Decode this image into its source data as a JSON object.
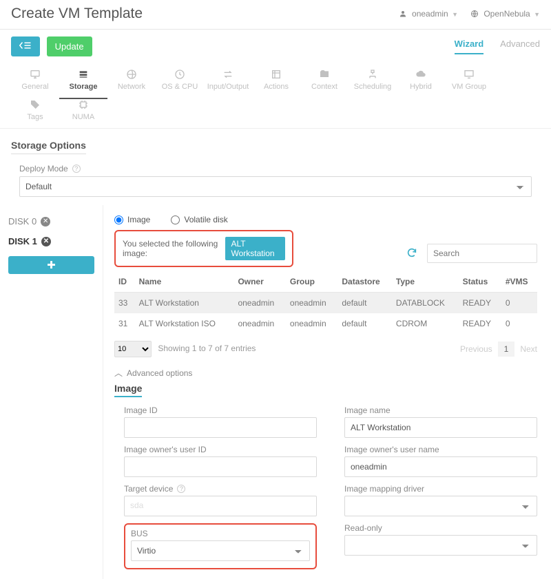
{
  "header": {
    "title": "Create VM Template",
    "user": "oneadmin",
    "zone": "OpenNebula"
  },
  "actions": {
    "update_label": "Update"
  },
  "view_tabs": {
    "wizard": "Wizard",
    "advanced": "Advanced"
  },
  "tabs": [
    "General",
    "Storage",
    "Network",
    "OS & CPU",
    "Input/Output",
    "Actions",
    "Context",
    "Scheduling",
    "Hybrid",
    "VM Group",
    "Tags",
    "NUMA"
  ],
  "section_title": "Storage Options",
  "deploy_mode": {
    "label": "Deploy Mode",
    "value": "Default"
  },
  "disks": {
    "items": [
      "DISK 0",
      "DISK 1"
    ],
    "active": 1
  },
  "disk_type": {
    "image": "Image",
    "volatile": "Volatile disk",
    "selected": "image"
  },
  "selected_msg": {
    "prefix": "You selected the following image:",
    "badge": "ALT Workstation"
  },
  "search": {
    "placeholder": "Search"
  },
  "table": {
    "headers": [
      "ID",
      "Name",
      "Owner",
      "Group",
      "Datastore",
      "Type",
      "Status",
      "#VMS"
    ],
    "rows": [
      {
        "id": "33",
        "name": "ALT Workstation",
        "owner": "oneadmin",
        "group": "oneadmin",
        "datastore": "default",
        "type": "DATABLOCK",
        "status": "READY",
        "vms": "0",
        "selected": true
      },
      {
        "id": "31",
        "name": "ALT Workstation ISO",
        "owner": "oneadmin",
        "group": "oneadmin",
        "datastore": "default",
        "type": "CDROM",
        "status": "READY",
        "vms": "0",
        "selected": false
      }
    ]
  },
  "pager": {
    "size": "10",
    "info": "Showing 1 to 7 of 7 entries",
    "prev": "Previous",
    "page": "1",
    "next": "Next"
  },
  "advanced": {
    "toggle": "Advanced options",
    "section": "Image"
  },
  "fields": {
    "image_id": {
      "label": "Image ID",
      "value": ""
    },
    "image_name": {
      "label": "Image name",
      "value": "ALT Workstation"
    },
    "owner_id": {
      "label": "Image owner's user ID",
      "value": ""
    },
    "owner_name": {
      "label": "Image owner's user name",
      "value": "oneadmin"
    },
    "target": {
      "label": "Target device",
      "hint": "sda"
    },
    "mapping": {
      "label": "Image mapping driver",
      "value": ""
    },
    "bus": {
      "label": "BUS",
      "value": "Virtio"
    },
    "readonly": {
      "label": "Read-only",
      "value": ""
    }
  }
}
